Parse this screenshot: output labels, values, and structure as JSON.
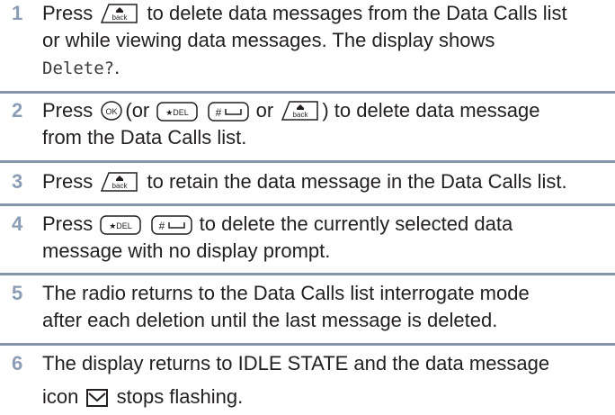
{
  "steps": [
    {
      "num": "1",
      "l1a": "Press",
      "l1b": "to delete data messages from the Data Calls list",
      "l2": "or while viewing data messages. The display shows",
      "l3mono": "Delete?",
      "l3end": "."
    },
    {
      "num": "2",
      "l1a": "Press",
      "l1b": "(or",
      "l1c": "or",
      "l1d": ") to delete data message",
      "l2": "from the Data Calls list."
    },
    {
      "num": "3",
      "l1a": "Press",
      "l1b": "to retain the data message in the Data Calls list."
    },
    {
      "num": "4",
      "l1a": "Press",
      "l1b": "to delete the currently selected data",
      "l2": "message with no display prompt."
    },
    {
      "num": "5",
      "l1": "The radio returns to the Data Calls list interrogate mode",
      "l2": "after each deletion until the last message is deleted."
    },
    {
      "num": "6",
      "l1": "The display returns to IDLE STATE and the data message",
      "l2a": "icon",
      "l2b": "stops flashing."
    }
  ],
  "keys": {
    "back": "back",
    "ok": "OK",
    "star": "★DEL",
    "hash": "#"
  },
  "icons": [
    "back-key-icon",
    "ok-key-icon",
    "star-del-key-icon",
    "hash-key-icon",
    "data-message-icon"
  ],
  "colors": {
    "step_number": "#8a9db4",
    "divider": "#8596ac",
    "text": "#231f20"
  }
}
